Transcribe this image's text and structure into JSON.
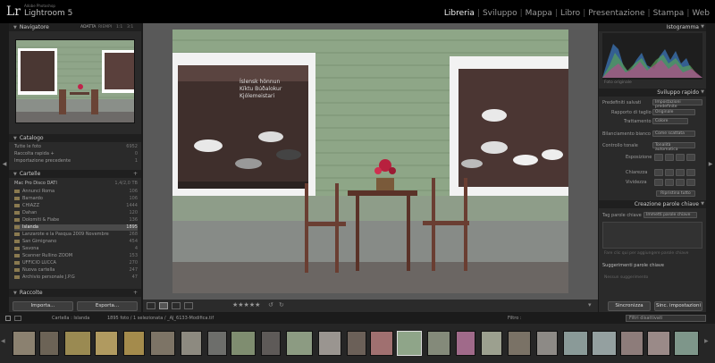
{
  "app": {
    "logo": "Lr",
    "subtitle": "Adobe Photoshop",
    "name": "Lightroom 5"
  },
  "modules": [
    "Libreria",
    "Sviluppo",
    "Mappa",
    "Libro",
    "Presentazione",
    "Stampa",
    "Web"
  ],
  "active_module": "Libreria",
  "left": {
    "navigator": {
      "title": "Navigatore",
      "zoom": [
        "ADATTA",
        "RIEMPI",
        "1:1",
        "3:1"
      ]
    },
    "catalog": {
      "title": "Catalogo",
      "items": [
        {
          "label": "Tutte le foto",
          "count": "6952"
        },
        {
          "label": "Raccolta rapida +",
          "count": "0"
        },
        {
          "label": "Importazione precedente",
          "count": "1"
        }
      ]
    },
    "folders": {
      "title": "Cartelle",
      "drive": "Mac Pro Disco DATI",
      "drive_info": "1,4/2,0 TB",
      "items": [
        {
          "label": "Annunci Roma",
          "count": "106"
        },
        {
          "label": "Barnardo",
          "count": "106"
        },
        {
          "label": "CHIAZZ",
          "count": "1444"
        },
        {
          "label": "Dahan",
          "count": "120"
        },
        {
          "label": "Dolomiti & Fiabe",
          "count": "136"
        },
        {
          "label": "Islanda",
          "count": "1895"
        },
        {
          "label": "Lanzarote e la Pasqua 2009 Novembre",
          "count": "268"
        },
        {
          "label": "San Gimignano",
          "count": "454"
        },
        {
          "label": "Savona",
          "count": "4"
        },
        {
          "label": "Scanner Rullino ZOOM",
          "count": "153"
        },
        {
          "label": "UFFICIO LUCCA",
          "count": "270"
        },
        {
          "label": "Nuova cartella",
          "count": "247"
        },
        {
          "label": "Archivio personale J.P.G",
          "count": "47"
        }
      ]
    },
    "collections": {
      "title": "Raccolte"
    },
    "import_label": "Importa...",
    "export_label": "Esporta..."
  },
  "toolbar": {
    "stars": "★★★★★",
    "sort": "Ordina per: Ora di acquisizione"
  },
  "right": {
    "histogram": {
      "title": "Istogramma",
      "original": "Foto originale"
    },
    "quick_develop": {
      "title": "Sviluppo rapido",
      "saved_preset_label": "Predefiniti salvati",
      "saved_preset_value": "Impostazioni predefinite",
      "crop_label": "Rapporto di taglio",
      "crop_value": "Originale",
      "treatment_label": "Trattamento",
      "treatment_value": "Colore",
      "wb_label": "Bilanciamento bianco",
      "wb_value": "Come scattata",
      "tone_label": "Controllo tonale",
      "tone_value": "Tonalità automatica",
      "exposure_label": "Esposizione",
      "clarity_label": "Chiarezza",
      "vibrance_label": "Vividezza",
      "reset_label": "Ripristina tutto"
    },
    "keywords": {
      "title": "Creazione parole chiave",
      "tag_label": "Tag parole chiave",
      "tag_value": "Immetti parole chiave",
      "placeholder": "Fare clic qui per aggiungere parole chiave",
      "suggest_title": "Suggerimenti parole chiave",
      "suggest_sub": "Nessun suggerimento"
    },
    "sync_label": "Sincronizza",
    "sync_settings_label": "Sinc. impostazioni"
  },
  "bottom": {
    "source": "Cartella : Islanda",
    "info": "1895 foto / 1 selezionata / _AJ_6133-Modifica.tif",
    "filter_label": "Filtro :",
    "filter_value": "Filtri disattivati"
  }
}
